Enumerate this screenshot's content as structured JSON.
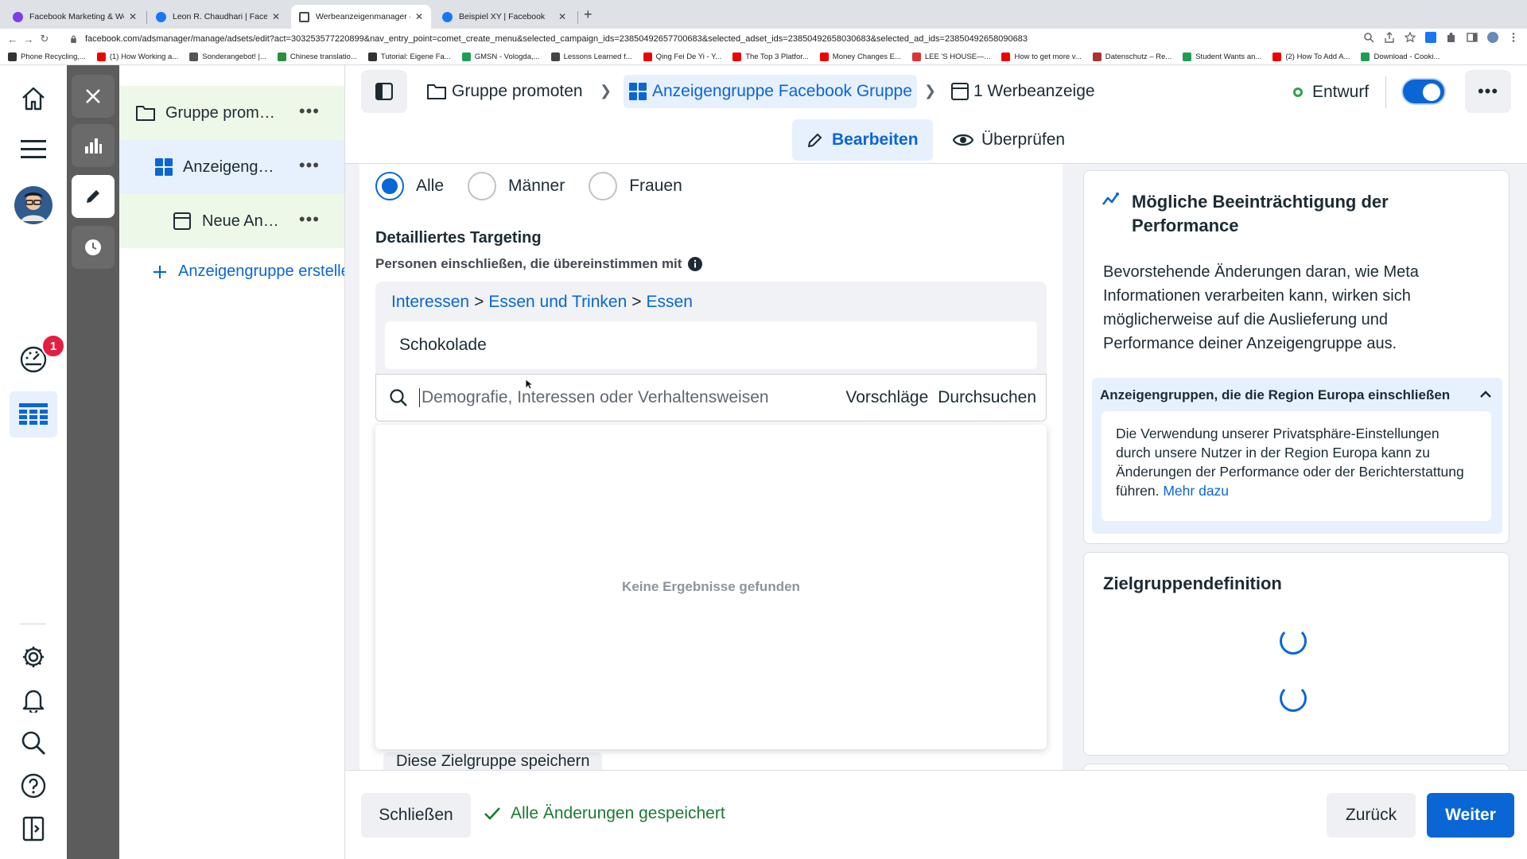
{
  "browser": {
    "tabs": [
      {
        "label": "Facebook Marketing & Werbea…",
        "color": "#7b3fe4"
      },
      {
        "label": "Leon R. Chaudhari | Facebook",
        "color": "#1877f2"
      },
      {
        "label": "Werbeanzeigenmanager – Wer…",
        "color": "#444"
      },
      {
        "label": "Beispiel XY | Facebook",
        "color": "#1877f2"
      }
    ],
    "url": "facebook.com/adsmanager/manage/adsets/edit?act=303253577220899&nav_entry_point=comet_create_menu&selected_campaign_ids=23850492657700683&selected_adset_ids=23850492658030683&selected_ad_ids=23850492658090683",
    "bookmarks": [
      {
        "label": "Phone Recycling,...",
        "color": "#333"
      },
      {
        "label": "(1) How Working a...",
        "color": "#e00"
      },
      {
        "label": "Sonderangebot! |...",
        "color": "#555"
      },
      {
        "label": "Chinese translatio...",
        "color": "#2a8f3a"
      },
      {
        "label": "Tutorial: Eigene Fa...",
        "color": "#333"
      },
      {
        "label": "GMSN - Vologda,...",
        "color": "#1f9d55"
      },
      {
        "label": "Lessons Learned f...",
        "color": "#444"
      },
      {
        "label": "Qing Fei De Yi - Y...",
        "color": "#e00"
      },
      {
        "label": "The Top 3 Platfor...",
        "color": "#e00"
      },
      {
        "label": "Money Changes E...",
        "color": "#e00"
      },
      {
        "label": "LEE 'S HOUSE—...",
        "color": "#d33"
      },
      {
        "label": "How to get more v...",
        "color": "#e00"
      },
      {
        "label": "Datenschutz – Re...",
        "color": "#a33"
      },
      {
        "label": "Student Wants an...",
        "color": "#1f9d55"
      },
      {
        "label": "(2) How To Add A...",
        "color": "#e00"
      },
      {
        "label": "Download - Cooki...",
        "color": "#1f9d55"
      }
    ]
  },
  "leftnav": {
    "notification_count": "1"
  },
  "tree": {
    "campaign": "Gruppe prom…",
    "adset": "Anzeigeng…",
    "ad": "Neue An…",
    "create_adset": "Anzeigengruppe erstellen",
    "more": "•••"
  },
  "header": {
    "breadcrumb": {
      "campaign": "Gruppe promoten",
      "adset": "Anzeigengruppe Facebook Gruppe",
      "ad": "1 Werbeanzeige"
    },
    "status": "Entwurf",
    "more": "•••",
    "mode_edit": "Bearbeiten",
    "mode_review": "Überprüfen"
  },
  "form": {
    "gender_options": [
      "Alle",
      "Männer",
      "Frauen"
    ],
    "gender_selected": "Alle",
    "detailed_targeting_heading": "Detailliertes Targeting",
    "detailed_targeting_sub": "Personen einschließen, die übereinstimmen mit",
    "path": [
      "Interessen",
      "Essen und Trinken",
      "Essen"
    ],
    "path_separator": ">",
    "selected_interest": "Schokolade",
    "search_placeholder": "Demografie, Interessen oder Verhaltensweisen",
    "suggestions_link": "Vorschläge",
    "browse_link": "Durchsuchen",
    "no_results": "Keine Ergebnisse gefunden",
    "save_audience": "Diese Zielgruppe speichern"
  },
  "right": {
    "perf_title": "Mögliche Beeinträchtigung der Performance",
    "perf_body": "Bevorstehende Änderungen daran, wie Meta Informationen verarbeiten kann, wirken sich möglicherweise auf die Auslieferung und Performance deiner Anzeigengruppe aus.",
    "europe_heading": "Anzeigengruppen, die die Region Europa einschließen",
    "europe_body": "Die Verwendung unserer Privatsphäre-Einstellungen durch unsere Nutzer in der Region Europa kann zu Änderungen der Performance oder der Berichterstattung führen.",
    "europe_link": "Mehr dazu",
    "audience_title": "Zielgruppendefinition"
  },
  "footer": {
    "close": "Schließen",
    "saved": "Alle Änderungen gespeichert",
    "back": "Zurück",
    "next": "Weiter"
  },
  "colors": {
    "accent": "#0a66d4",
    "status_green": "#31a24c",
    "badge_red": "#e41e3f"
  }
}
